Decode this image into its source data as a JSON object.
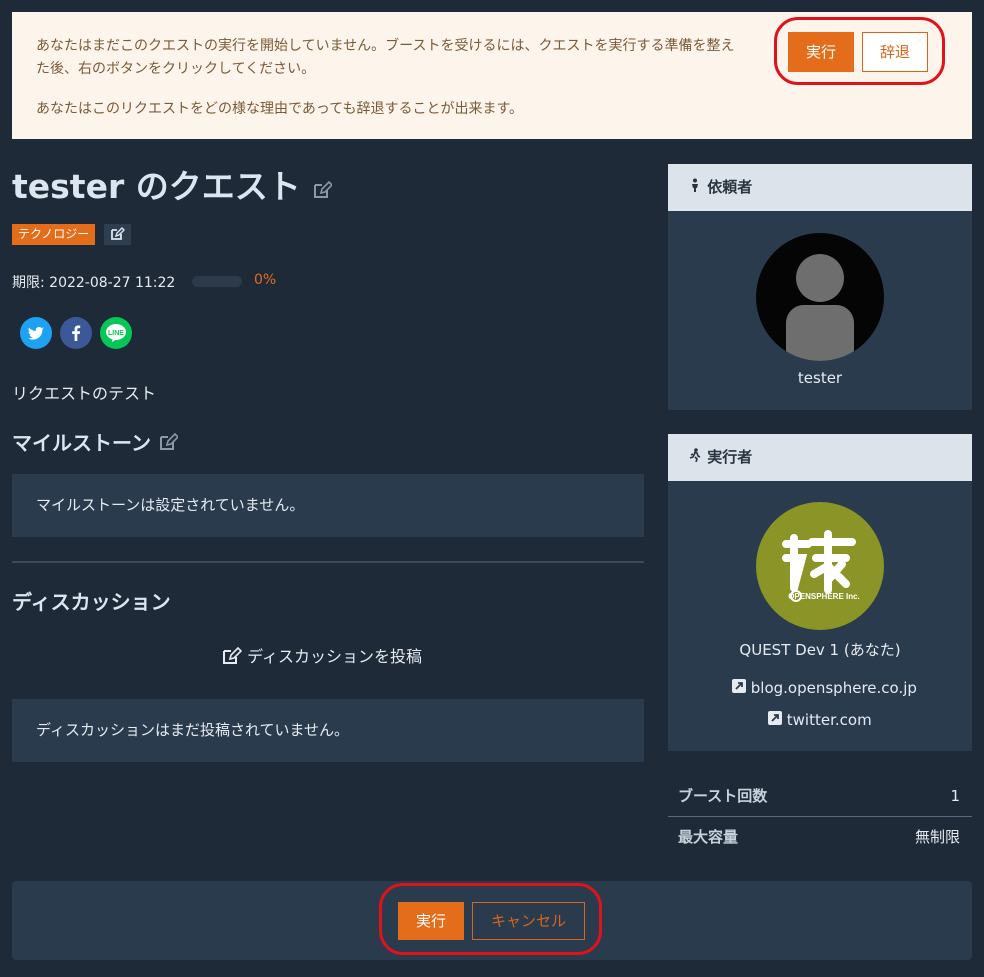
{
  "notice": {
    "line1": "あなたはまだこのクエストの実行を開始していません。ブーストを受けるには、クエストを実行する準備を整えた後、右のボタンをクリックしてください。",
    "line2": "あなたはこのリクエストをどの様な理由であっても辞退することが出来ます。",
    "exec_label": "実行",
    "decline_label": "辞退"
  },
  "quest": {
    "title": "tester のクエスト",
    "tag": "テクノロジー",
    "deadline": "期限: 2022-08-27 11:22",
    "progress_pct": 0,
    "progress_label": "0%",
    "description": "リクエストのテスト"
  },
  "milestones": {
    "heading": "マイルストーン",
    "empty": "マイルストーンは設定されていません。"
  },
  "discussion": {
    "heading": "ディスカッション",
    "post_label": "ディスカッションを投稿",
    "empty": "ディスカッションはまだ投稿されていません。"
  },
  "requester": {
    "heading": "依頼者",
    "name": "tester"
  },
  "executor": {
    "heading": "実行者",
    "name": "QUEST Dev 1 (あなた)",
    "logo_text": "OPENSPHERE Inc.",
    "links": [
      "blog.opensphere.co.jp",
      "twitter.com"
    ]
  },
  "stats": [
    {
      "label": "ブースト回数",
      "value": "1"
    },
    {
      "label": "最大容量",
      "value": "無制限"
    }
  ],
  "footer": {
    "exec_label": "実行",
    "cancel_label": "キャンセル"
  },
  "colors": {
    "accent": "#e36d1b",
    "background": "#1e2a38",
    "panel": "#2a3b4d",
    "highlight_ring": "#e0121b"
  },
  "icons": [
    "edit-icon",
    "person-icon",
    "runner-icon",
    "twitter-icon",
    "facebook-icon",
    "line-icon",
    "external-link-icon"
  ]
}
